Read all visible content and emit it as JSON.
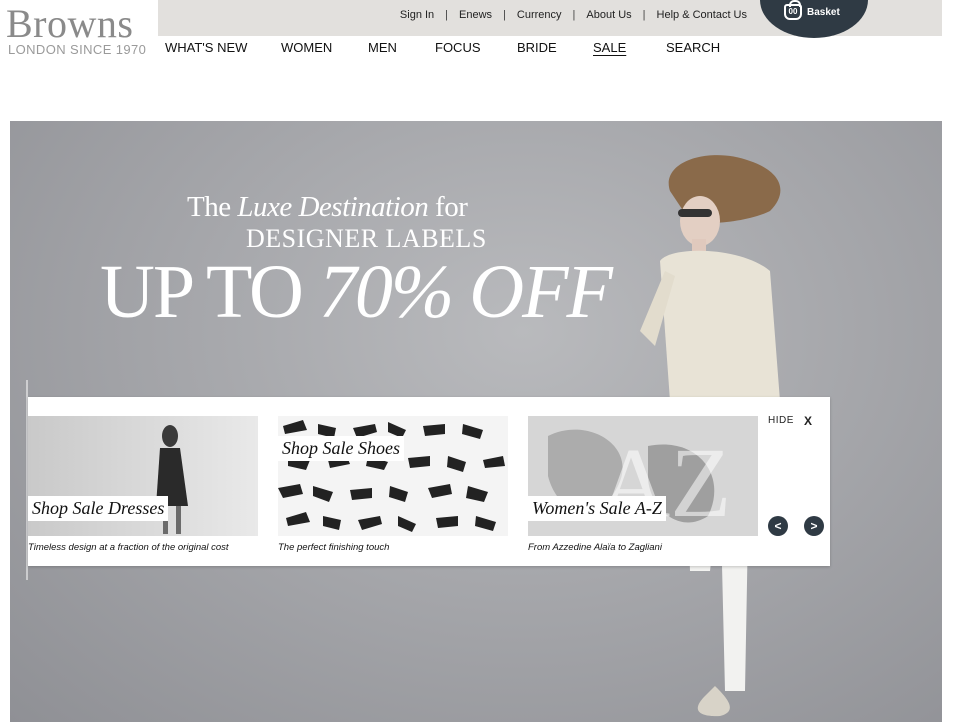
{
  "logo": {
    "word": "Browns",
    "tagline": "LONDON SINCE 1970"
  },
  "utility_nav": [
    {
      "label": "Sign In"
    },
    {
      "label": "Enews"
    },
    {
      "label": "Currency"
    },
    {
      "label": "About Us"
    },
    {
      "label": "Help & Contact Us"
    }
  ],
  "basket": {
    "count": "00",
    "label": "Basket"
  },
  "main_nav": [
    {
      "label": "WHAT'S NEW"
    },
    {
      "label": "WOMEN"
    },
    {
      "label": "MEN"
    },
    {
      "label": "FOCUS"
    },
    {
      "label": "BRIDE"
    },
    {
      "label": "SALE",
      "active": true
    },
    {
      "label": "SEARCH"
    }
  ],
  "hero": {
    "line1_pre": "The ",
    "line1_em": "Luxe Destination",
    "line1_post": " for",
    "line2": "DESIGNER LABELS",
    "line3_pre": "UP TO ",
    "line3_em": "70% OFF"
  },
  "promo": {
    "hide_label": "HIDE",
    "close_glyph": "X",
    "prev_glyph": "<",
    "next_glyph": ">",
    "cards": [
      {
        "title": "Shop Sale Dresses",
        "desc": "Timeless design at a fraction of the original cost"
      },
      {
        "title": "Shop Sale Shoes",
        "desc": "The perfect finishing touch"
      },
      {
        "title": "Women's Sale A-Z",
        "desc": "From Azzedine Alaïa to Zagliani",
        "image_letters": "AZ"
      }
    ]
  },
  "colors": {
    "topbar": "#e2e0dd",
    "basket": "#2f3a44",
    "hero_bg": "#a6a7ab"
  }
}
